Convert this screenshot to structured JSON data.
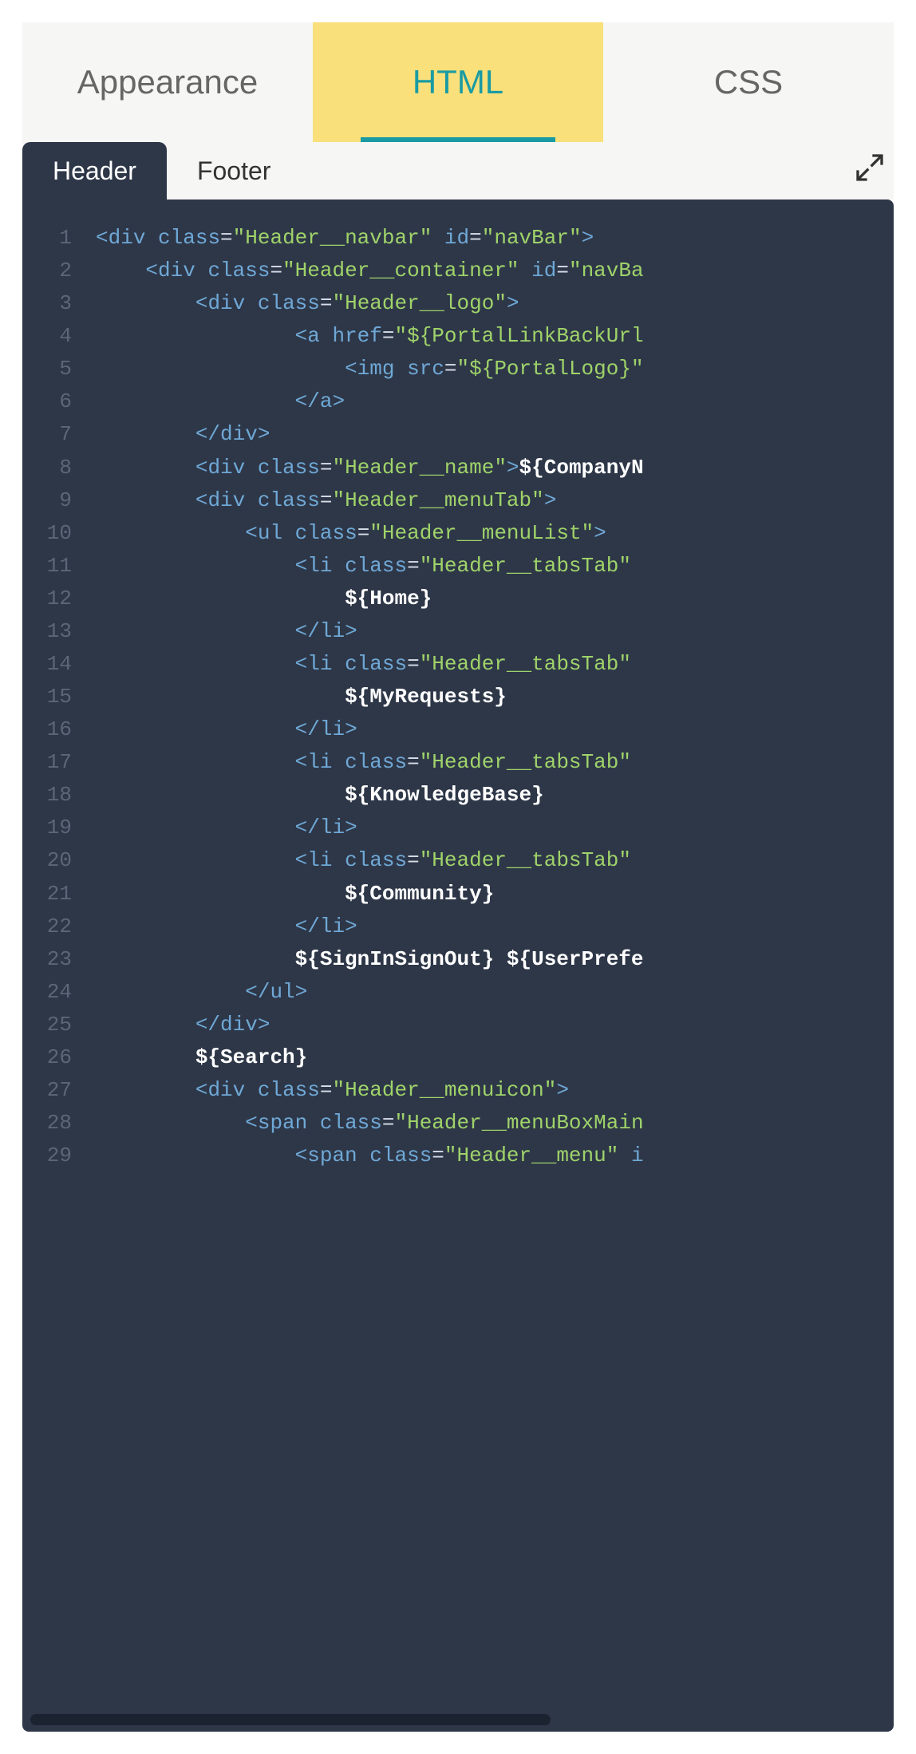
{
  "topTabs": {
    "appearance": "Appearance",
    "html": "HTML",
    "css": "CSS",
    "active": "html"
  },
  "subTabs": {
    "header": "Header",
    "footer": "Footer",
    "active": "header"
  },
  "code": {
    "lines": [
      {
        "n": "1",
        "tokens": [
          {
            "t": "punc",
            "v": "<"
          },
          {
            "t": "tag",
            "v": "div"
          },
          {
            "t": "plain",
            "v": " "
          },
          {
            "t": "attr",
            "v": "class"
          },
          {
            "t": "eq",
            "v": "="
          },
          {
            "t": "str",
            "v": "\"Header__navbar\""
          },
          {
            "t": "plain",
            "v": " "
          },
          {
            "t": "attr",
            "v": "id"
          },
          {
            "t": "eq",
            "v": "="
          },
          {
            "t": "str",
            "v": "\"navBar\""
          },
          {
            "t": "punc",
            "v": ">"
          }
        ]
      },
      {
        "n": "2",
        "tokens": [
          {
            "t": "plain",
            "v": "    "
          },
          {
            "t": "punc",
            "v": "<"
          },
          {
            "t": "tag",
            "v": "div"
          },
          {
            "t": "plain",
            "v": " "
          },
          {
            "t": "attr",
            "v": "class"
          },
          {
            "t": "eq",
            "v": "="
          },
          {
            "t": "str",
            "v": "\"Header__container\""
          },
          {
            "t": "plain",
            "v": " "
          },
          {
            "t": "attr",
            "v": "id"
          },
          {
            "t": "eq",
            "v": "="
          },
          {
            "t": "str",
            "v": "\"navBa"
          }
        ]
      },
      {
        "n": "3",
        "tokens": [
          {
            "t": "plain",
            "v": "        "
          },
          {
            "t": "punc",
            "v": "<"
          },
          {
            "t": "tag",
            "v": "div"
          },
          {
            "t": "plain",
            "v": " "
          },
          {
            "t": "attr",
            "v": "class"
          },
          {
            "t": "eq",
            "v": "="
          },
          {
            "t": "str",
            "v": "\"Header__logo\""
          },
          {
            "t": "punc",
            "v": ">"
          }
        ]
      },
      {
        "n": "4",
        "tokens": [
          {
            "t": "plain",
            "v": "                "
          },
          {
            "t": "punc",
            "v": "<"
          },
          {
            "t": "tag",
            "v": "a"
          },
          {
            "t": "plain",
            "v": " "
          },
          {
            "t": "attr",
            "v": "href"
          },
          {
            "t": "eq",
            "v": "="
          },
          {
            "t": "str",
            "v": "\"${PortalLinkBackUrl"
          }
        ]
      },
      {
        "n": "5",
        "tokens": [
          {
            "t": "plain",
            "v": "                    "
          },
          {
            "t": "punc",
            "v": "<"
          },
          {
            "t": "tag",
            "v": "img"
          },
          {
            "t": "plain",
            "v": " "
          },
          {
            "t": "attr",
            "v": "src"
          },
          {
            "t": "eq",
            "v": "="
          },
          {
            "t": "str",
            "v": "\"${PortalLogo}\""
          }
        ]
      },
      {
        "n": "6",
        "tokens": [
          {
            "t": "plain",
            "v": "                "
          },
          {
            "t": "punc",
            "v": "</"
          },
          {
            "t": "tag",
            "v": "a"
          },
          {
            "t": "punc",
            "v": ">"
          }
        ]
      },
      {
        "n": "7",
        "tokens": [
          {
            "t": "plain",
            "v": "        "
          },
          {
            "t": "punc",
            "v": "</"
          },
          {
            "t": "tag",
            "v": "div"
          },
          {
            "t": "punc",
            "v": ">"
          }
        ]
      },
      {
        "n": "8",
        "tokens": [
          {
            "t": "plain",
            "v": "        "
          },
          {
            "t": "punc",
            "v": "<"
          },
          {
            "t": "tag",
            "v": "div"
          },
          {
            "t": "plain",
            "v": " "
          },
          {
            "t": "attr",
            "v": "class"
          },
          {
            "t": "eq",
            "v": "="
          },
          {
            "t": "str",
            "v": "\"Header__name\""
          },
          {
            "t": "punc",
            "v": ">"
          },
          {
            "t": "txt",
            "v": "${CompanyN"
          }
        ]
      },
      {
        "n": "9",
        "tokens": [
          {
            "t": "plain",
            "v": "        "
          },
          {
            "t": "punc",
            "v": "<"
          },
          {
            "t": "tag",
            "v": "div"
          },
          {
            "t": "plain",
            "v": " "
          },
          {
            "t": "attr",
            "v": "class"
          },
          {
            "t": "eq",
            "v": "="
          },
          {
            "t": "str",
            "v": "\"Header__menuTab\""
          },
          {
            "t": "punc",
            "v": ">"
          }
        ]
      },
      {
        "n": "10",
        "tokens": [
          {
            "t": "plain",
            "v": "            "
          },
          {
            "t": "punc",
            "v": "<"
          },
          {
            "t": "tag",
            "v": "ul"
          },
          {
            "t": "plain",
            "v": " "
          },
          {
            "t": "attr",
            "v": "class"
          },
          {
            "t": "eq",
            "v": "="
          },
          {
            "t": "str",
            "v": "\"Header__menuList\""
          },
          {
            "t": "punc",
            "v": ">"
          }
        ]
      },
      {
        "n": "11",
        "tokens": [
          {
            "t": "plain",
            "v": "                "
          },
          {
            "t": "punc",
            "v": "<"
          },
          {
            "t": "tag",
            "v": "li"
          },
          {
            "t": "plain",
            "v": " "
          },
          {
            "t": "attr",
            "v": "class"
          },
          {
            "t": "eq",
            "v": "="
          },
          {
            "t": "str",
            "v": "\"Header__tabsTab\""
          }
        ]
      },
      {
        "n": "12",
        "tokens": [
          {
            "t": "plain",
            "v": "                    "
          },
          {
            "t": "txt",
            "v": "${Home}"
          }
        ]
      },
      {
        "n": "13",
        "tokens": [
          {
            "t": "plain",
            "v": "                "
          },
          {
            "t": "punc",
            "v": "</"
          },
          {
            "t": "tag",
            "v": "li"
          },
          {
            "t": "punc",
            "v": ">"
          }
        ]
      },
      {
        "n": "14",
        "tokens": [
          {
            "t": "plain",
            "v": "                "
          },
          {
            "t": "punc",
            "v": "<"
          },
          {
            "t": "tag",
            "v": "li"
          },
          {
            "t": "plain",
            "v": " "
          },
          {
            "t": "attr",
            "v": "class"
          },
          {
            "t": "eq",
            "v": "="
          },
          {
            "t": "str",
            "v": "\"Header__tabsTab\""
          }
        ]
      },
      {
        "n": "15",
        "tokens": [
          {
            "t": "plain",
            "v": "                    "
          },
          {
            "t": "txt",
            "v": "${MyRequests}"
          }
        ]
      },
      {
        "n": "16",
        "tokens": [
          {
            "t": "plain",
            "v": "                "
          },
          {
            "t": "punc",
            "v": "</"
          },
          {
            "t": "tag",
            "v": "li"
          },
          {
            "t": "punc",
            "v": ">"
          }
        ]
      },
      {
        "n": "17",
        "tokens": [
          {
            "t": "plain",
            "v": "                "
          },
          {
            "t": "punc",
            "v": "<"
          },
          {
            "t": "tag",
            "v": "li"
          },
          {
            "t": "plain",
            "v": " "
          },
          {
            "t": "attr",
            "v": "class"
          },
          {
            "t": "eq",
            "v": "="
          },
          {
            "t": "str",
            "v": "\"Header__tabsTab\""
          }
        ]
      },
      {
        "n": "18",
        "tokens": [
          {
            "t": "plain",
            "v": "                    "
          },
          {
            "t": "txt",
            "v": "${KnowledgeBase}"
          }
        ]
      },
      {
        "n": "19",
        "tokens": [
          {
            "t": "plain",
            "v": "                "
          },
          {
            "t": "punc",
            "v": "</"
          },
          {
            "t": "tag",
            "v": "li"
          },
          {
            "t": "punc",
            "v": ">"
          }
        ]
      },
      {
        "n": "20",
        "tokens": [
          {
            "t": "plain",
            "v": "                "
          },
          {
            "t": "punc",
            "v": "<"
          },
          {
            "t": "tag",
            "v": "li"
          },
          {
            "t": "plain",
            "v": " "
          },
          {
            "t": "attr",
            "v": "class"
          },
          {
            "t": "eq",
            "v": "="
          },
          {
            "t": "str",
            "v": "\"Header__tabsTab\""
          }
        ]
      },
      {
        "n": "21",
        "tokens": [
          {
            "t": "plain",
            "v": "                    "
          },
          {
            "t": "txt",
            "v": "${Community}"
          }
        ]
      },
      {
        "n": "22",
        "tokens": [
          {
            "t": "plain",
            "v": "                "
          },
          {
            "t": "punc",
            "v": "</"
          },
          {
            "t": "tag",
            "v": "li"
          },
          {
            "t": "punc",
            "v": ">"
          }
        ]
      },
      {
        "n": "23",
        "tokens": [
          {
            "t": "plain",
            "v": "                "
          },
          {
            "t": "txt",
            "v": "${SignInSignOut} ${UserPrefe"
          }
        ]
      },
      {
        "n": "24",
        "tokens": [
          {
            "t": "plain",
            "v": "            "
          },
          {
            "t": "punc",
            "v": "</"
          },
          {
            "t": "tag",
            "v": "ul"
          },
          {
            "t": "punc",
            "v": ">"
          }
        ]
      },
      {
        "n": "25",
        "tokens": [
          {
            "t": "plain",
            "v": "        "
          },
          {
            "t": "punc",
            "v": "</"
          },
          {
            "t": "tag",
            "v": "div"
          },
          {
            "t": "punc",
            "v": ">"
          }
        ]
      },
      {
        "n": "26",
        "tokens": [
          {
            "t": "plain",
            "v": "        "
          },
          {
            "t": "txt",
            "v": "${Search}"
          }
        ]
      },
      {
        "n": "27",
        "tokens": [
          {
            "t": "plain",
            "v": "        "
          },
          {
            "t": "punc",
            "v": "<"
          },
          {
            "t": "tag",
            "v": "div"
          },
          {
            "t": "plain",
            "v": " "
          },
          {
            "t": "attr",
            "v": "class"
          },
          {
            "t": "eq",
            "v": "="
          },
          {
            "t": "str",
            "v": "\"Header__menuicon\""
          },
          {
            "t": "punc",
            "v": ">"
          }
        ]
      },
      {
        "n": "28",
        "tokens": [
          {
            "t": "plain",
            "v": "            "
          },
          {
            "t": "punc",
            "v": "<"
          },
          {
            "t": "tag",
            "v": "span"
          },
          {
            "t": "plain",
            "v": " "
          },
          {
            "t": "attr",
            "v": "class"
          },
          {
            "t": "eq",
            "v": "="
          },
          {
            "t": "str",
            "v": "\"Header__menuBoxMain"
          }
        ]
      },
      {
        "n": "29",
        "tokens": [
          {
            "t": "plain",
            "v": "                "
          },
          {
            "t": "punc",
            "v": "<"
          },
          {
            "t": "tag",
            "v": "span"
          },
          {
            "t": "plain",
            "v": " "
          },
          {
            "t": "attr",
            "v": "class"
          },
          {
            "t": "eq",
            "v": "="
          },
          {
            "t": "str",
            "v": "\"Header__menu\""
          },
          {
            "t": "plain",
            "v": " "
          },
          {
            "t": "attr",
            "v": "i"
          }
        ]
      }
    ]
  }
}
